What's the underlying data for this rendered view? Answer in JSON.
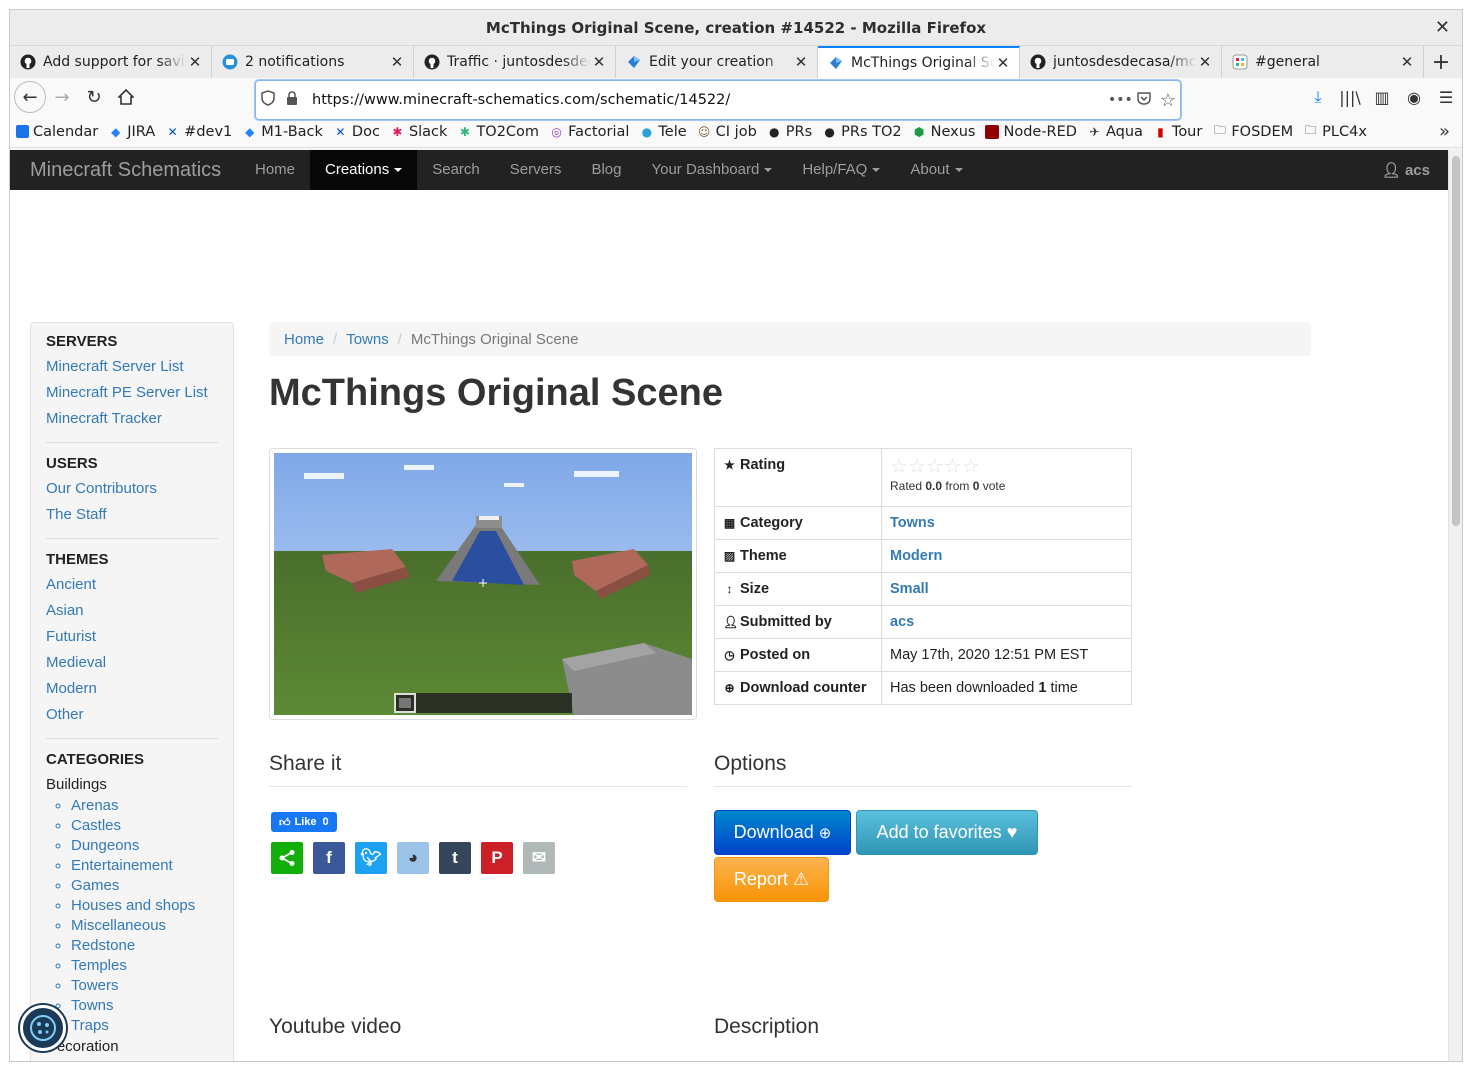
{
  "window": {
    "title": "McThings Original Scene, creation #14522 - Mozilla Firefox"
  },
  "tabs": [
    {
      "label": "Add support for saving",
      "icon": "github-icon"
    },
    {
      "label": "2 notifications",
      "icon": "notification-icon"
    },
    {
      "label": "Traffic · juntosdesdecasa",
      "icon": "github-icon"
    },
    {
      "label": "Edit your creation",
      "icon": "minecraft-schematics-icon"
    },
    {
      "label": "McThings Original Scene",
      "icon": "minecraft-schematics-icon",
      "active": true
    },
    {
      "label": "juntosdesdecasa/mcthings",
      "icon": "github-icon"
    },
    {
      "label": "#general",
      "icon": "slack-icon"
    }
  ],
  "urlbar": {
    "url": "https://www.minecraft-schematics.com/schematic/14522/"
  },
  "bookmarks": [
    {
      "label": "Calendar",
      "icon": "calendar-icon"
    },
    {
      "label": "JIRA",
      "icon": "jira-icon"
    },
    {
      "label": "#dev1",
      "icon": "confluence-icon"
    },
    {
      "label": "M1-Back",
      "icon": "jira-icon"
    },
    {
      "label": "Doc",
      "icon": "confluence-icon"
    },
    {
      "label": "Slack",
      "icon": "slack-icon"
    },
    {
      "label": "TO2Com",
      "icon": "slack-icon"
    },
    {
      "label": "Factorial",
      "icon": "factorial-icon"
    },
    {
      "label": "Tele",
      "icon": "telegram-icon"
    },
    {
      "label": "CI job",
      "icon": "jenkins-icon"
    },
    {
      "label": "PRs",
      "icon": "github-icon"
    },
    {
      "label": "PRs TO2",
      "icon": "github-icon"
    },
    {
      "label": "Nexus",
      "icon": "nexus-icon"
    },
    {
      "label": "Node-RED",
      "icon": "node-red-icon"
    },
    {
      "label": "Aqua",
      "icon": "aqua-icon"
    },
    {
      "label": "Tour",
      "icon": "tour-icon"
    },
    {
      "label": "FOSDEM",
      "icon": "folder-icon"
    },
    {
      "label": "PLC4x",
      "icon": "folder-icon"
    }
  ],
  "site": {
    "brand": "Minecraft Schematics",
    "nav": [
      {
        "label": "Home",
        "dropdown": false
      },
      {
        "label": "Creations",
        "dropdown": true,
        "active": true
      },
      {
        "label": "Search",
        "dropdown": false
      },
      {
        "label": "Servers",
        "dropdown": false
      },
      {
        "label": "Blog",
        "dropdown": false
      },
      {
        "label": "Your Dashboard",
        "dropdown": true
      },
      {
        "label": "Help/FAQ",
        "dropdown": true
      },
      {
        "label": "About",
        "dropdown": true
      }
    ],
    "user": "acs"
  },
  "sidebar": {
    "servers": {
      "title": "SERVERS",
      "links": [
        "Minecraft Server List",
        "Minecraft PE Server List",
        "Minecraft Tracker"
      ]
    },
    "users": {
      "title": "USERS",
      "links": [
        "Our Contributors",
        "The Staff"
      ]
    },
    "themes": {
      "title": "THEMES",
      "links": [
        "Ancient",
        "Asian",
        "Futurist",
        "Medieval",
        "Modern",
        "Other"
      ]
    },
    "categories": {
      "title": "CATEGORIES",
      "buildings_label": "Buildings",
      "buildings": [
        "Arenas",
        "Castles",
        "Dungeons",
        "Entertainement",
        "Games",
        "Houses and shops",
        "Miscellaneous",
        "Redstone",
        "Temples",
        "Towers",
        "Towns",
        "Traps"
      ],
      "decoration_label": "Decoration"
    }
  },
  "breadcrumb": {
    "home": "Home",
    "category": "Towns",
    "current": "McThings Original Scene"
  },
  "page_title": "McThings Original Scene",
  "details": {
    "rating_label": "Rating",
    "rating_stars": "☆☆☆☆☆",
    "rated_prefix": "Rated ",
    "rated_value": "0.0",
    "rated_mid": " from ",
    "rated_votes": "0",
    "rated_suffix": " vote",
    "category_label": "Category",
    "category_value": "Towns",
    "theme_label": "Theme",
    "theme_value": "Modern",
    "size_label": "Size",
    "size_value": "Small",
    "submitted_label": "Submitted by",
    "submitted_value": "acs",
    "posted_label": "Posted on",
    "posted_value": "May 17th, 2020 12:51 PM EST",
    "download_label": "Download counter",
    "download_prefix": "Has been downloaded ",
    "download_count": "1",
    "download_suffix": " time"
  },
  "share": {
    "heading": "Share it",
    "like_label": "Like",
    "like_count": "0",
    "buttons": [
      "share-icon",
      "facebook-icon",
      "twitter-icon",
      "reddit-icon",
      "tumblr-icon",
      "pinterest-icon",
      "email-icon"
    ]
  },
  "options": {
    "heading": "Options",
    "download_label": "Download",
    "favorites_label": "Add to favorites",
    "report_label": "Report"
  },
  "sections_below": {
    "youtube": "Youtube video",
    "description": "Description"
  }
}
